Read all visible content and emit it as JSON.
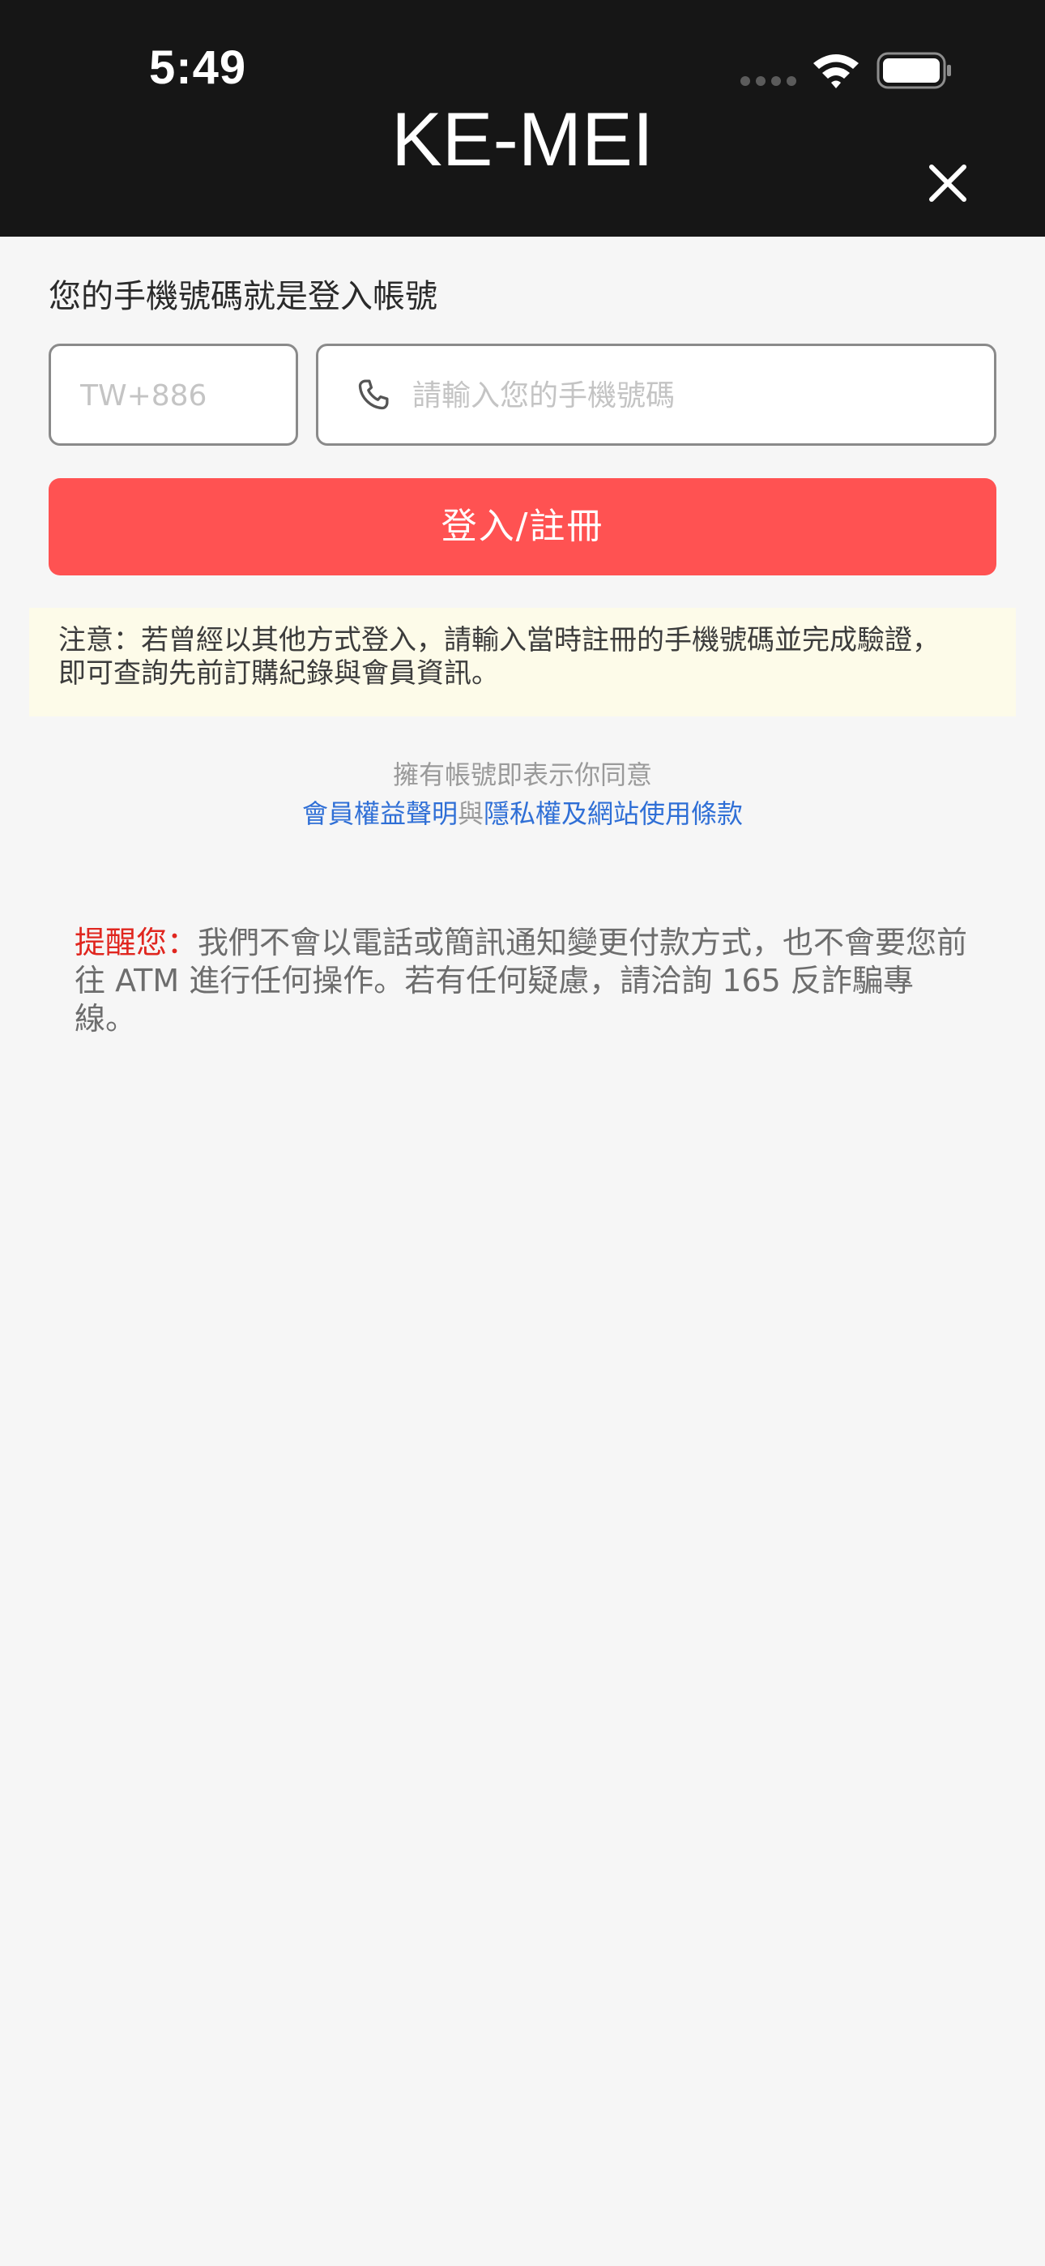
{
  "status_bar": {
    "time": "5:49"
  },
  "header": {
    "title": "KE-MEI",
    "close_icon": "close-icon"
  },
  "login": {
    "heading": "您的手機號碼就是登入帳號",
    "country_code_placeholder": "TW+886",
    "phone_placeholder": "請輸入您的手機號碼",
    "phone_icon": "phone-icon",
    "submit_label": "登入/註冊"
  },
  "notice": {
    "line1": "注意：若曾經以其他方式登入，請輸入當時註冊的手機號碼並完成驗證，",
    "line2": "即可查詢先前訂購紀錄與會員資訊。"
  },
  "agreement": {
    "prefix": "擁有帳號即表示你同意",
    "member_rights_link": "會員權益聲明",
    "joiner": "與",
    "privacy_link": "隱私權及網站使用條款"
  },
  "reminder": {
    "lead": "提醒您：",
    "body": "我們不會以電話或簡訊通知變更付款方式，也不會要您前往 ATM 進行任何操作。若有任何疑慮，請洽詢 165 反詐騙專線。"
  },
  "colors": {
    "header_bg": "#161616",
    "primary_button": "#ff5252",
    "notice_bg": "#fdfbe9",
    "link": "#2f6fd6",
    "reminder_lead": "#e0261f"
  }
}
